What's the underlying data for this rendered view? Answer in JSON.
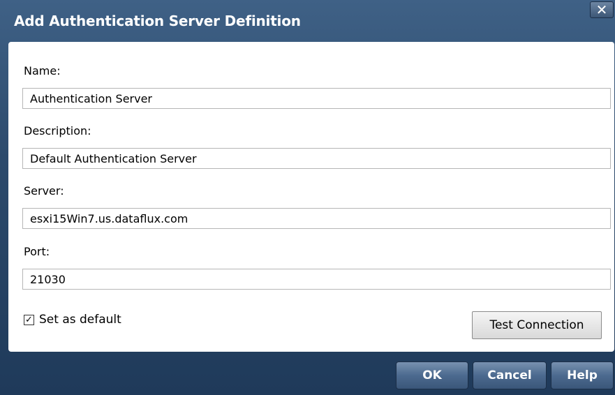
{
  "dialog": {
    "title": "Add Authentication Server Definition",
    "close_symbol": "✕"
  },
  "fields": {
    "name": {
      "label": "Name:",
      "value": "Authentication Server"
    },
    "description": {
      "label": "Description:",
      "value": "Default Authentication Server"
    },
    "server": {
      "label": "Server:",
      "value": "esxi15Win7.us.dataflux.com"
    },
    "port": {
      "label": "Port:",
      "value": "21030"
    }
  },
  "set_default": {
    "label": "Set as default",
    "checked": true,
    "check_mark": "✓"
  },
  "buttons": {
    "test_connection": "Test Connection",
    "ok": "OK",
    "cancel": "Cancel",
    "help": "Help"
  }
}
